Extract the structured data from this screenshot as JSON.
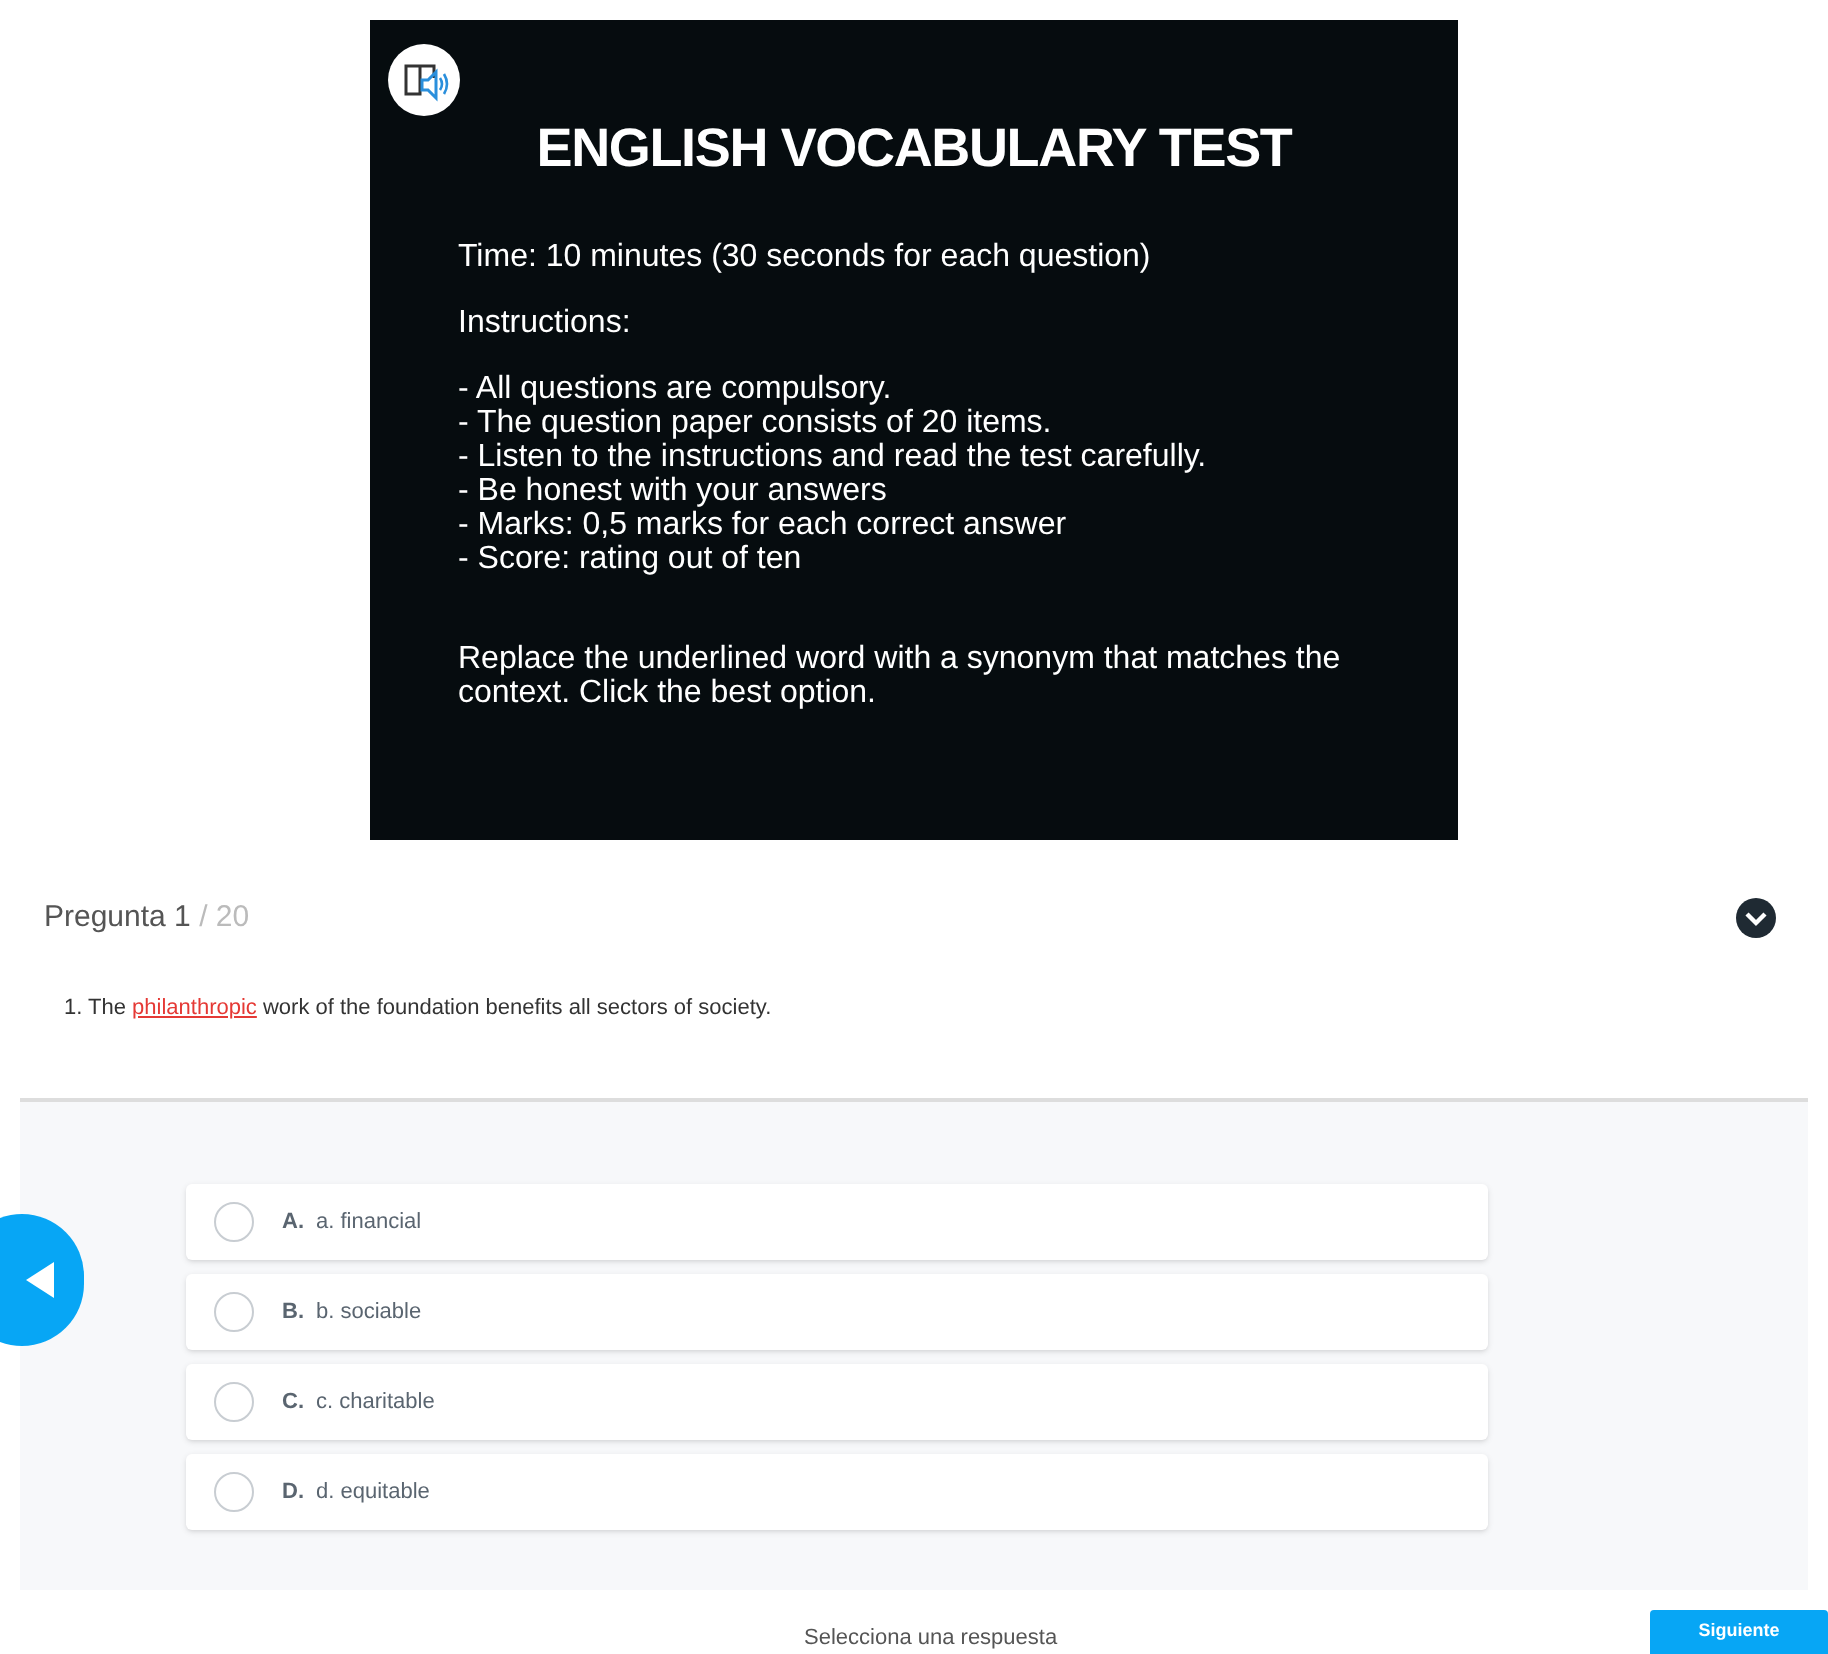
{
  "slide": {
    "title": "ENGLISH VOCABULARY TEST",
    "time": "Time: 10 minutes (30 seconds for each question)",
    "instructions_heading": "Instructions:",
    "rules": [
      "- All questions are compulsory.",
      "- The question paper consists of 20 items.",
      "- Listen to the instructions and read the test carefully.",
      "- Be honest with your answers",
      "- Marks: 0,5 marks for each correct answer",
      "- Score: rating out of ten"
    ],
    "task": "Replace the underlined word with a synonym that matches the context. Click the best option."
  },
  "header": {
    "label": "Pregunta 1",
    "total": "/ 20"
  },
  "question": {
    "before": "1. The ",
    "highlight": "philanthropic",
    "after": " work of the foundation benefits all sectors of society."
  },
  "options": [
    {
      "letter": "A.",
      "text": "a. financial",
      "selected": false
    },
    {
      "letter": "B.",
      "text": "b. sociable",
      "selected": false
    },
    {
      "letter": "C.",
      "text": "c. charitable",
      "selected": false
    },
    {
      "letter": "D.",
      "text": "d. equitable",
      "selected": false
    }
  ],
  "footer": {
    "status": "Selecciona una respuesta",
    "next_button": "Siguiente"
  }
}
